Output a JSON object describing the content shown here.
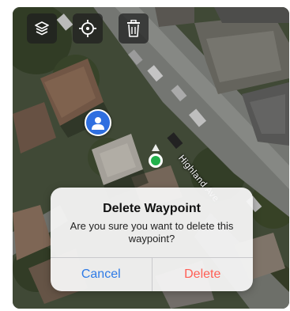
{
  "toolbar": {
    "buttons": [
      {
        "icon": "layers-icon"
      },
      {
        "icon": "crosshair-icon"
      },
      {
        "icon": "trash-icon"
      }
    ]
  },
  "map": {
    "street_label": "Highland Ave",
    "view": "satellite"
  },
  "dialog": {
    "title": "Delete Waypoint",
    "message": "Are you sure you want to delete this waypoint?",
    "cancel_label": "Cancel",
    "delete_label": "Delete"
  },
  "colors": {
    "cancel_text": "#2e7be6",
    "delete_text": "#ff5f55",
    "avatar_pin": "#2f6fe0",
    "location_dot": "#22b14c"
  }
}
